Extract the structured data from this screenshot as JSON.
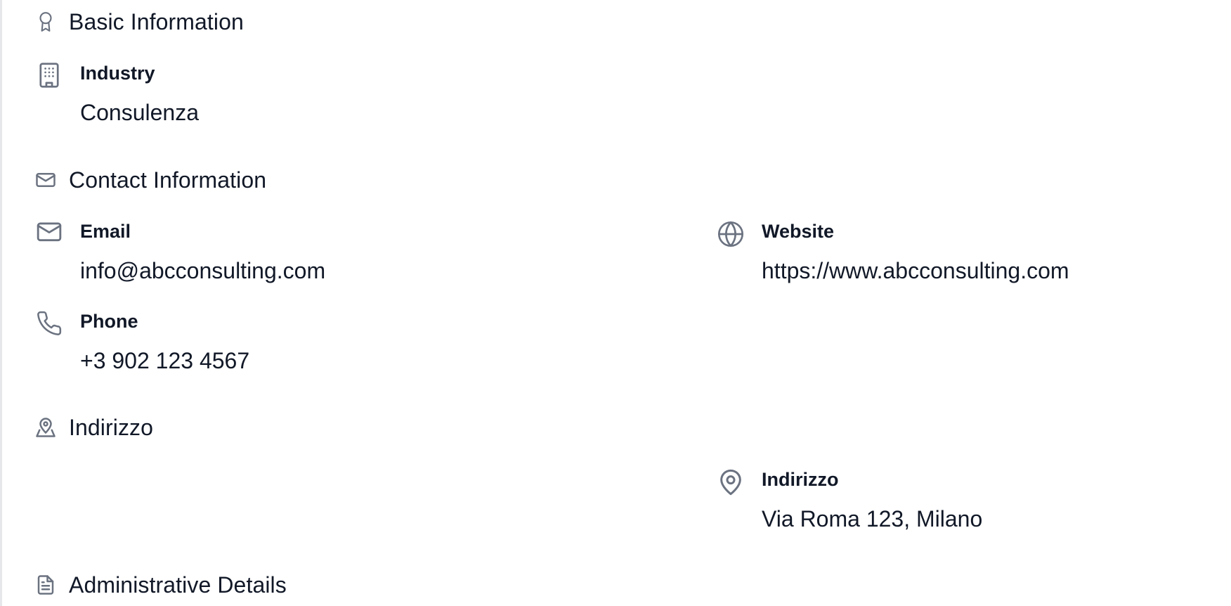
{
  "sections": {
    "basic": {
      "title": "Basic Information",
      "icon": "award-icon",
      "industry": {
        "label": "Industry",
        "value": "Consulenza",
        "icon": "building-icon"
      }
    },
    "contact": {
      "title": "Contact Information",
      "icon": "mail-icon",
      "email": {
        "label": "Email",
        "value": "info@abcconsulting.com",
        "icon": "mail-icon"
      },
      "website": {
        "label": "Website",
        "value": "https://www.abcconsulting.com",
        "icon": "globe-icon"
      },
      "phone": {
        "label": "Phone",
        "value": "+3 902 123 4567",
        "icon": "phone-icon"
      }
    },
    "address": {
      "title": "Indirizzo",
      "icon": "map-user-icon",
      "address": {
        "label": "Indirizzo",
        "value": "Via Roma 123, Milano",
        "icon": "map-pin-icon"
      }
    },
    "admin": {
      "title": "Administrative Details",
      "icon": "file-text-icon"
    }
  },
  "colors": {
    "icon": "#6b7280",
    "text": "#111827",
    "rule": "#e5e7eb"
  }
}
